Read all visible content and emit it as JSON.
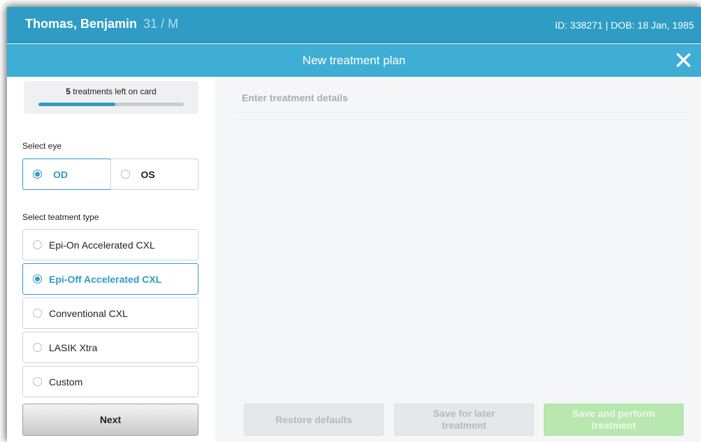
{
  "patient": {
    "name": "Thomas, Benjamin",
    "age_sex": "31 / M",
    "ids": "ID: 338271 | DOB: 18 Jan, 1985"
  },
  "title_bar": {
    "title": "New treatment plan",
    "close_icon": "close-icon"
  },
  "card": {
    "count": "5",
    "text": " treatments left on card",
    "progress_fraction": 0.53
  },
  "eye": {
    "label": "Select eye",
    "options": [
      "OD",
      "OS"
    ],
    "selected": "OD"
  },
  "treatment_type": {
    "label": "Select teatment type",
    "options": [
      "Epi-On Accelerated CXL",
      "Epi-Off Accelerated CXL",
      "Conventional CXL",
      "LASIK Xtra",
      "Custom"
    ],
    "selected": "Epi-Off Accelerated CXL"
  },
  "next_label": "Next",
  "main": {
    "heading": "Enter treatment details"
  },
  "footer": {
    "restore_label": "Restore defaults",
    "save_later_line1": "Save for later",
    "save_later_line2": "treatment",
    "save_perform_line1": "Save and perform",
    "save_perform_line2": "treatment"
  },
  "colors": {
    "accent": "#2e9cc4",
    "header": "#2e9cc4",
    "title_bar": "#3faed4",
    "save_perform_disabled": "#b9e7b0"
  }
}
